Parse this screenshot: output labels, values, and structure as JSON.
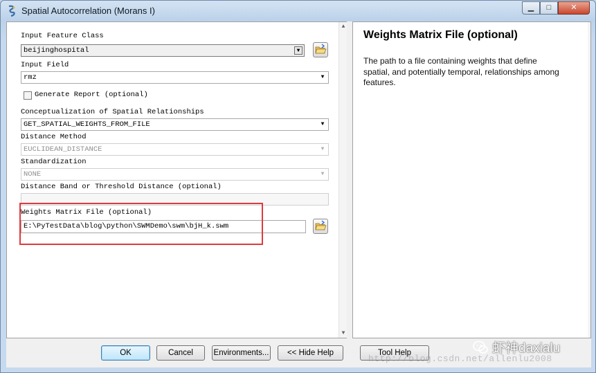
{
  "window": {
    "title": "Spatial Autocorrelation (Morans I)"
  },
  "params": {
    "input_feature_class": {
      "label": "Input Feature Class",
      "value": "beijinghospital"
    },
    "input_field": {
      "label": "Input Field",
      "value": "rmz"
    },
    "generate_report": {
      "label": "Generate Report (optional)",
      "checked": false
    },
    "conceptualization": {
      "label": "Conceptualization of Spatial Relationships",
      "value": "GET_SPATIAL_WEIGHTS_FROM_FILE"
    },
    "distance_method": {
      "label": "Distance Method",
      "value": "EUCLIDEAN_DISTANCE"
    },
    "standardization": {
      "label": "Standardization",
      "value": "NONE"
    },
    "distance_band": {
      "label": "Distance Band or Threshold Distance (optional)",
      "value": ""
    },
    "weights_matrix_file": {
      "label": "Weights Matrix File (optional)",
      "value": "E:\\PyTestData\\blog\\python\\SWMDemo\\swm\\bjH_k.swm"
    }
  },
  "help": {
    "title": "Weights Matrix File (optional)",
    "body": "The path to a file containing weights that define spatial, and potentially temporal, relationships among features."
  },
  "buttons": {
    "ok": "OK",
    "cancel": "Cancel",
    "environments": "Environments...",
    "hide_help": "<< Hide Help",
    "tool_help": "Tool Help"
  },
  "watermark": {
    "text": "虾神daxialu",
    "url": "http://blog.csdn.net/allenlu2008"
  },
  "colors": {
    "highlight_box": "#e0383c",
    "default_button": "#bee6fd"
  }
}
